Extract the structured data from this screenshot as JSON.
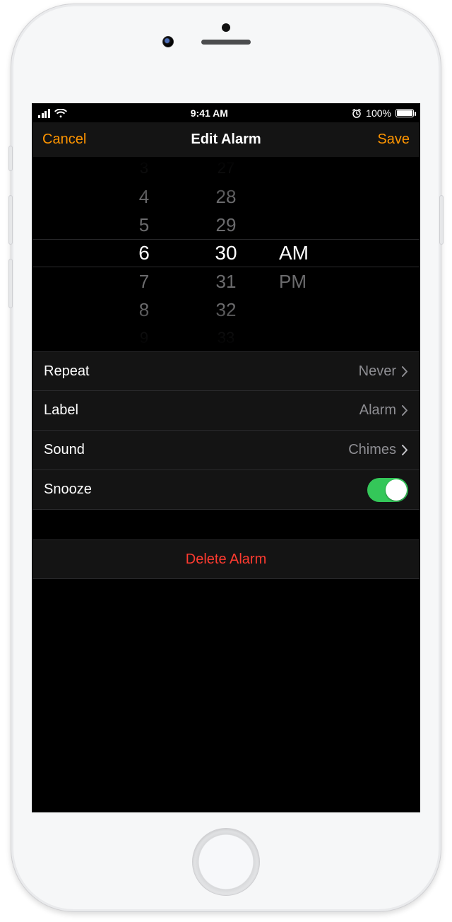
{
  "status": {
    "time": "9:41 AM",
    "battery_pct": "100%"
  },
  "nav": {
    "cancel": "Cancel",
    "title": "Edit Alarm",
    "save": "Save"
  },
  "picker": {
    "hours_far_above_2": "3",
    "hours_far_above": "4",
    "hours_above": "5",
    "hours_selected": "6",
    "hours_below": "7",
    "hours_far_below": "8",
    "hours_far_below_2": "9",
    "mins_far_above_2": "27",
    "mins_far_above": "28",
    "mins_above": "29",
    "mins_selected": "30",
    "mins_below": "31",
    "mins_far_below": "32",
    "mins_far_below_2": "33",
    "period_selected": "AM",
    "period_below": "PM"
  },
  "settings": {
    "repeat_label": "Repeat",
    "repeat_value": "Never",
    "label_label": "Label",
    "label_value": "Alarm",
    "sound_label": "Sound",
    "sound_value": "Chimes",
    "snooze_label": "Snooze",
    "snooze_on": true
  },
  "delete_label": "Delete Alarm"
}
